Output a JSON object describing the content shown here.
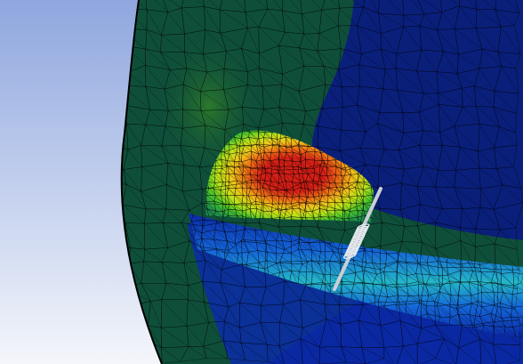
{
  "viewport": {
    "background_top": "#8fa7df",
    "background_bottom": "#f4f6fb"
  },
  "model": {
    "outer_body_color": "#0f4f3a",
    "inner_body_color": "#0a1f7a",
    "channel_color_dark": "#0b2aa8",
    "channel_color_mid": "#1466d8",
    "channel_color_light": "#24b7c9",
    "mesh_line_color": "#000000"
  },
  "contour": {
    "colors": [
      "#d61f16",
      "#ef6a16",
      "#f2c21a",
      "#bde419",
      "#48c72c",
      "#1fbf9a",
      "#1e8fe0",
      "#0a2fcf"
    ]
  },
  "probe": {
    "shaft_color": "#c9ced6",
    "coil_color": "#e8ebef"
  }
}
